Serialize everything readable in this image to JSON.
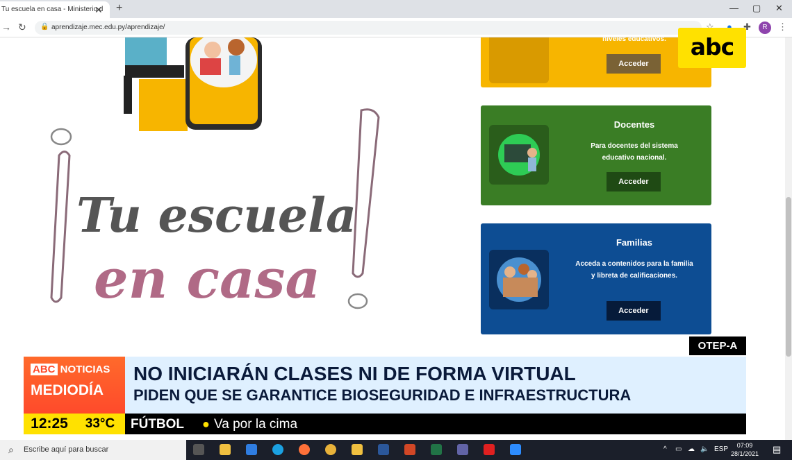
{
  "browser": {
    "tab_title": "Tu escuela en casa - Ministerio d",
    "url": "aprendizaje.mec.edu.py/aprendizaje/",
    "profile_initial": "R"
  },
  "page": {
    "hero_line1": "Tu escuela",
    "hero_line2": "en casa",
    "cards": [
      {
        "title": "",
        "desc": "niveles educativos.",
        "button": "Acceder",
        "color": "#f7b500"
      },
      {
        "title": "Docentes",
        "desc": "Para docentes del sistema educativo nacional.",
        "button": "Acceder",
        "color": "#3a7d25"
      },
      {
        "title": "Familias",
        "desc": "Acceda a contenidos para la familia y libreta de calificaciones.",
        "button": "Acceder",
        "color": "#0d4d93"
      }
    ]
  },
  "overlay": {
    "channel_logo": "abc",
    "source_tag": "OTEP-A",
    "brand_top_a": "ABC",
    "brand_top_b": "NOTICIAS",
    "brand_bottom": "MEDIODÍA",
    "headline": "NO INICIARÁN CLASES NI DE FORMA VIRTUAL",
    "subheadline": "PIDEN QUE SE GARANTICE BIOSEGURIDAD E INFRAESTRUCTURA",
    "time": "12:25",
    "temperature": "33°C",
    "ticker_category": "FÚTBOL",
    "ticker_text": "Va por la cima"
  },
  "taskbar": {
    "search_placeholder": "Escribe aquí para buscar",
    "language": "ESP",
    "clock_time": "07:09",
    "clock_date": "28/1/2021"
  }
}
